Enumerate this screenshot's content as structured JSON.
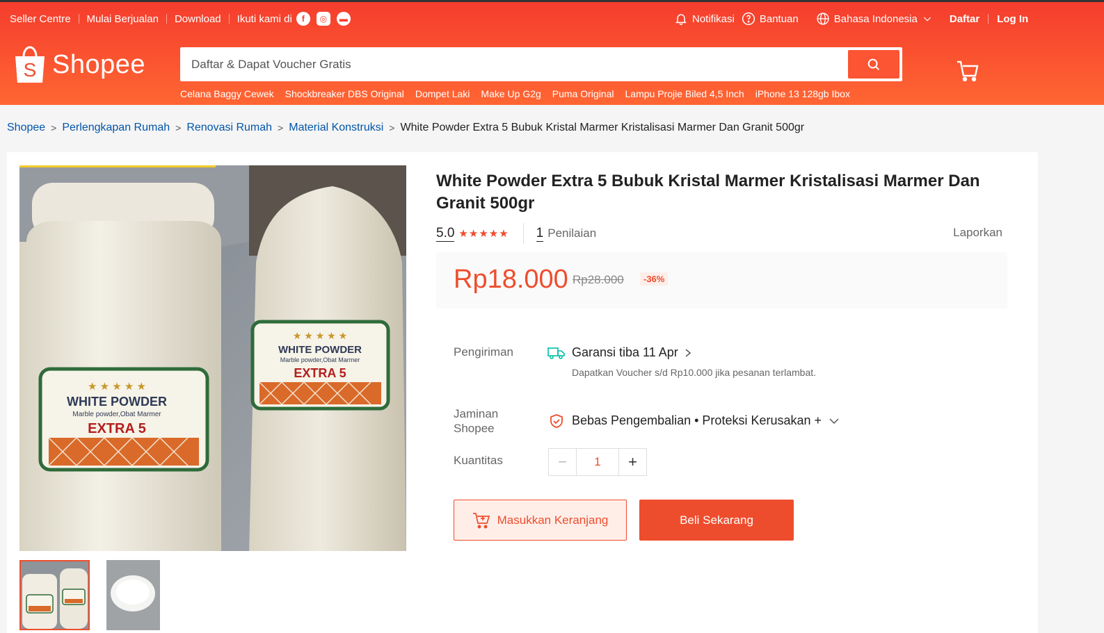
{
  "topnav": {
    "seller_centre": "Seller Centre",
    "start_selling": "Mulai Berjualan",
    "download": "Download",
    "follow_us": "Ikuti kami di",
    "notifications": "Notifikasi",
    "help": "Bantuan",
    "language": "Bahasa Indonesia",
    "signup": "Daftar",
    "login": "Log In"
  },
  "brand": {
    "name": "Shopee",
    "color": "#ee4d2d"
  },
  "search": {
    "placeholder": "Daftar & Dapat Voucher Gratis",
    "suggestions": [
      "Celana Baggy Cewek",
      "Shockbreaker DBS Original",
      "Dompet Laki",
      "Make Up G2g",
      "Puma Original",
      "Lampu Projie Biled 4,5 Inch",
      "iPhone 13 128gb Ibox"
    ]
  },
  "breadcrumb": {
    "items": [
      "Shopee",
      "Perlengkapan Rumah",
      "Renovasi Rumah",
      "Material Konstruksi"
    ],
    "current": "White Powder Extra 5 Bubuk Kristal Marmer Kristalisasi Marmer Dan Granit 500gr"
  },
  "product": {
    "title": "White Powder Extra 5 Bubuk Kristal Marmer Kristalisasi Marmer Dan Granit 500gr",
    "rating": "5.0",
    "rating_stars": 5,
    "review_count": "1",
    "review_label": "Penilaian",
    "report": "Laporkan",
    "price": "Rp18.000",
    "original_price": "Rp28.000",
    "discount": "-36%",
    "image_labels": {
      "brand": "WHITE POWDER",
      "subtitle": "Marble powder,Obat Marmer",
      "variant": "EXTRA 5"
    }
  },
  "shipping": {
    "label": "Pengiriman",
    "main": "Garansi tiba 11 Apr",
    "sub": "Dapatkan Voucher s/d Rp10.000 jika pesanan terlambat."
  },
  "guarantee": {
    "label_line1": "Jaminan",
    "label_line2": "Shopee",
    "text": "Bebas Pengembalian • Proteksi Kerusakan +"
  },
  "quantity": {
    "label": "Kuantitas",
    "value": "1",
    "minus": "−",
    "plus": "+"
  },
  "actions": {
    "add_to_cart": "Masukkan Keranjang",
    "buy_now": "Beli Sekarang"
  }
}
